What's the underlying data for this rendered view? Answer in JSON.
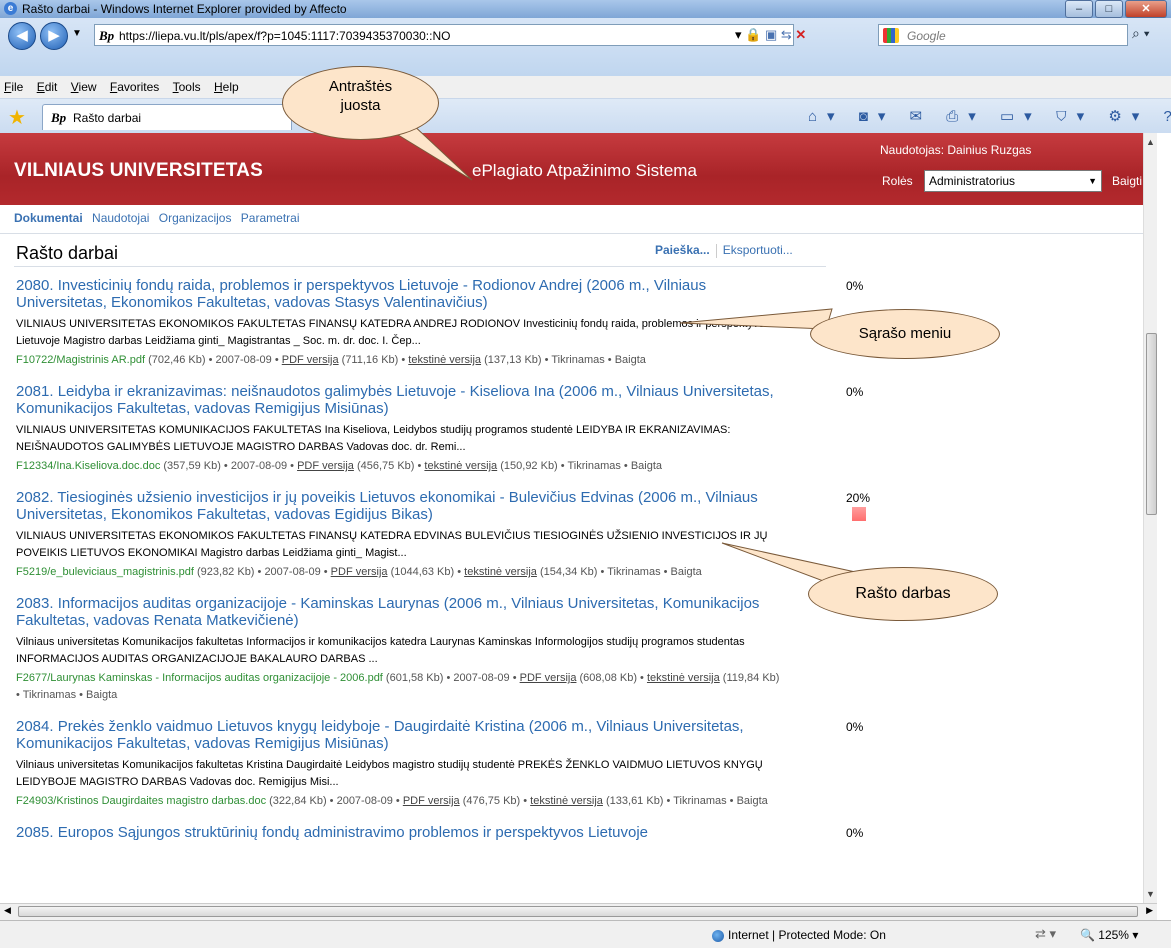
{
  "window": {
    "title": "Rašto darbai - Windows Internet Explorer provided by Affecto"
  },
  "browser": {
    "url": "https://liepa.vu.lt/pls/apex/f?p=1045:1117:7039435370030::NO",
    "search_placeholder": "Google",
    "menu": [
      "File",
      "Edit",
      "View",
      "Favorites",
      "Tools",
      "Help"
    ],
    "tab_title": "Rašto darbai",
    "status_zone": "Internet | Protected Mode: On",
    "zoom": "125%"
  },
  "header": {
    "university": "VILNIAUS UNIVERSITETAS",
    "system_name": "ePlagiato Atpažinimo Sistema",
    "user_label": "Naudotojas: Dainius Ruzgas",
    "roles_label": "Rolės",
    "role_selected": "Administratorius",
    "logout": "Baigti"
  },
  "subnav": [
    "Dokumentai",
    "Naudotojai",
    "Organizacijos",
    "Parametrai"
  ],
  "page": {
    "title": "Rašto darbai",
    "search_link": "Paieška...",
    "export_link": "Eksportuoti..."
  },
  "callouts": {
    "header": "Antraštės juosta",
    "menu": "Sąrašo meniu",
    "item": "Rašto darbas"
  },
  "results": [
    {
      "title": "2080. Investicinių fondų raida, problemos ir perspektyvos Lietuvoje - Rodionov Andrej (2006 m., Vilniaus Universitetas, Ekonomikos Fakultetas, vadovas Stasys Valentinavičius)",
      "percent": "0%",
      "snippet": "VILNIAUS UNIVERSITETAS EKONOMIKOS FAKULTETAS FINANSŲ KATEDRA ANDREJ RODIONOV Investicinių fondų raida, problemos ir perspektyvos Lietuvoje Magistro darbas Leidžiama ginti_ Magistrantas _ Soc. m. dr. doc. I. Čep...",
      "file": "F10722/Magistrinis AR.pdf",
      "file_size": " (702,46 Kb) • 2007-08-09 • ",
      "pdf_link": "PDF versija",
      "pdf_size": " (711,16 Kb) • ",
      "text_link": "tekstinė versija",
      "tail": " (137,13 Kb) • Tikrinamas • Baigta"
    },
    {
      "title": "2081. Leidyba ir ekranizavimas: neišnaudotos galimybės Lietuvoje - Kiseliova Ina (2006 m., Vilniaus Universitetas, Komunikacijos Fakultetas, vadovas Remigijus Misiūnas)",
      "percent": "0%",
      "snippet": "VILNIAUS UNIVERSITETAS KOMUNIKACIJOS FAKULTETAS Ina Kiseliova, Leidybos studijų programos studentė LEIDYBA IR EKRANIZAVIMAS: NEIŠNAUDOTOS GALIMYBĖS LIETUVOJE MAGISTRO DARBAS Vadovas doc. dr. Remi...",
      "file": "F12334/Ina.Kiseliova.doc.doc",
      "file_size": " (357,59 Kb) • 2007-08-09 • ",
      "pdf_link": "PDF versija",
      "pdf_size": " (456,75 Kb) • ",
      "text_link": "tekstinė versija",
      "tail": " (150,92 Kb) • Tikrinamas • Baigta"
    },
    {
      "title": "2082. Tiesioginės užsienio investicijos ir jų poveikis Lietuvos ekonomikai - Bulevičius Edvinas (2006 m., Vilniaus Universitetas, Ekonomikos Fakultetas, vadovas Egidijus Bikas)",
      "percent": "20%",
      "percent_value": 20,
      "snippet": "VILNIAUS UNIVERSITETAS EKONOMIKOS FAKULTETAS FINANSŲ KATEDRA EDVINAS BULEVIČIUS TIESIOGINĖS UŽSIENIO INVESTICIJOS IR JŲ POVEIKIS LIETUVOS EKONOMIKAI Magistro darbas Leidžiama ginti_ Magist...",
      "file": "F5219/e_buleviciaus_magistrinis.pdf",
      "file_size": " (923,82 Kb) • 2007-08-09 • ",
      "pdf_link": "PDF versija",
      "pdf_size": " (1044,63 Kb) • ",
      "text_link": "tekstinė versija",
      "tail": " (154,34 Kb) • Tikrinamas • Baigta"
    },
    {
      "title": "2083. Informacijos auditas organizacijoje - Kaminskas Laurynas (2006 m., Vilniaus Universitetas, Komunikacijos Fakultetas, vadovas Renata Matkevičienė)",
      "percent": "0%",
      "snippet": "Vilniaus universitetas Komunikacijos fakultetas Informacijos ir komunikacijos katedra Laurynas Kaminskas Informologijos studijų programos studentas INFORMACIJOS AUDITAS ORGANIZACIJOJE BAKALAURO DARBAS ...",
      "file": "F2677/Laurynas Kaminskas - Informacijos auditas organizacijoje - 2006.pdf",
      "file_size": " (601,58 Kb) • 2007-08-09 • ",
      "pdf_link": "PDF versija",
      "pdf_size": " (608,08 Kb) • ",
      "text_link": "tekstinė versija",
      "tail": " (119,84 Kb) • Tikrinamas • Baigta"
    },
    {
      "title": "2084. Prekės ženklo vaidmuo Lietuvos knygų leidyboje - Daugirdaitė Kristina (2006 m., Vilniaus Universitetas, Komunikacijos Fakultetas, vadovas Remigijus Misiūnas)",
      "percent": "0%",
      "snippet": "Vilniaus universitetas Komunikacijos fakultetas Kristina Daugirdaitė Leidybos magistro studijų studentė PREKĖS ŽENKLO VAIDMUO LIETUVOS KNYGŲ LEIDYBOJE MAGISTRO DARBAS Vadovas doc. Remigijus Misi...",
      "file": "F24903/Kristinos Daugirdaites magistro darbas.doc",
      "file_size": " (322,84 Kb) • 2007-08-09 • ",
      "pdf_link": "PDF versija",
      "pdf_size": " (476,75 Kb) • ",
      "text_link": "tekstinė versija",
      "tail": " (133,61 Kb) • Tikrinamas • Baigta"
    },
    {
      "title": "2085. Europos Sąjungos struktūrinių fondų administravimo problemos ir perspektyvos Lietuvoje",
      "percent": "0%",
      "snippet": "",
      "file": "",
      "file_size": "",
      "pdf_link": "",
      "pdf_size": "",
      "text_link": "",
      "tail": ""
    }
  ]
}
